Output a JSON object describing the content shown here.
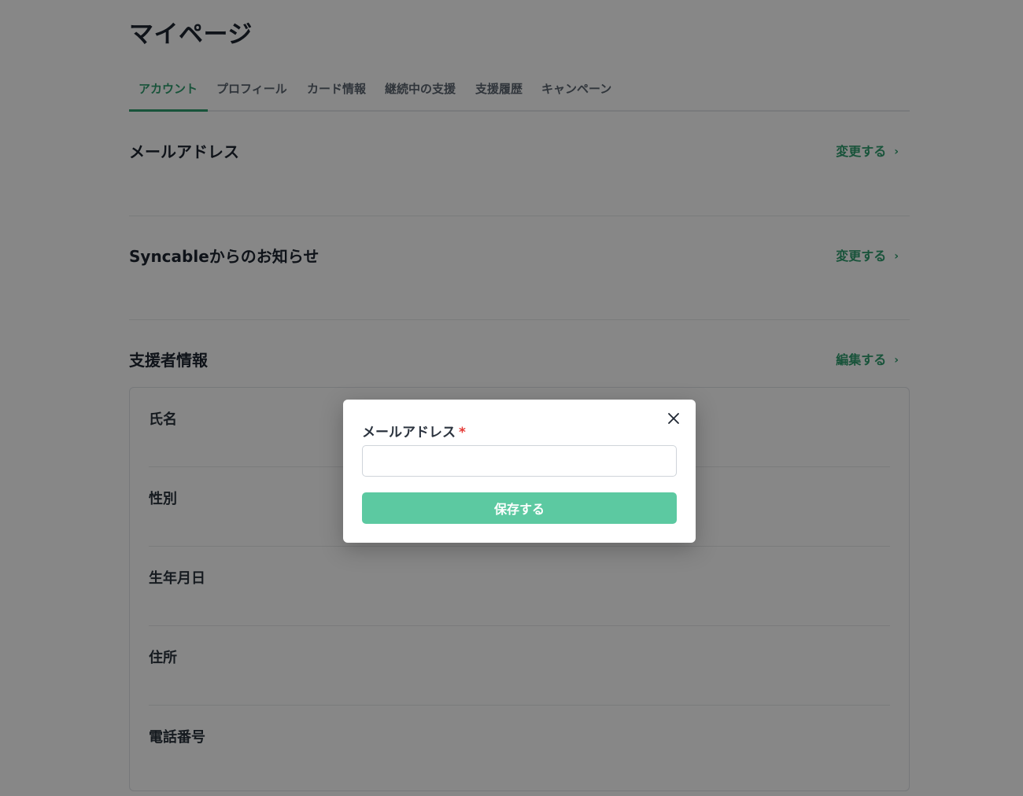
{
  "page": {
    "title": "マイページ"
  },
  "tabs": [
    {
      "label": "アカウント",
      "active": true
    },
    {
      "label": "プロフィール",
      "active": false
    },
    {
      "label": "カード情報",
      "active": false
    },
    {
      "label": "継続中の支援",
      "active": false
    },
    {
      "label": "支援履歴",
      "active": false
    },
    {
      "label": "キャンペーン",
      "active": false
    }
  ],
  "sections": [
    {
      "title": "メールアドレス",
      "link": "変更する"
    },
    {
      "title": "Syncableからのお知らせ",
      "link": "変更する"
    },
    {
      "title": "支援者情報",
      "link": "編集する"
    }
  ],
  "supporter_fields": [
    {
      "label": "氏名"
    },
    {
      "label": "性別"
    },
    {
      "label": "生年月日"
    },
    {
      "label": "住所"
    },
    {
      "label": "電話番号"
    }
  ],
  "modal": {
    "label": "メールアドレス",
    "required_mark": "*",
    "input_value": "",
    "input_placeholder": "",
    "save_label": "保存する"
  },
  "colors": {
    "accent": "#2f9e6e",
    "save_button": "#5cc9a1",
    "required": "#e53935",
    "overlay": "rgba(0,0,0,0.47)"
  },
  "icons": {
    "link_chevron": "chevron-right-icon",
    "modal_close": "close-icon"
  }
}
